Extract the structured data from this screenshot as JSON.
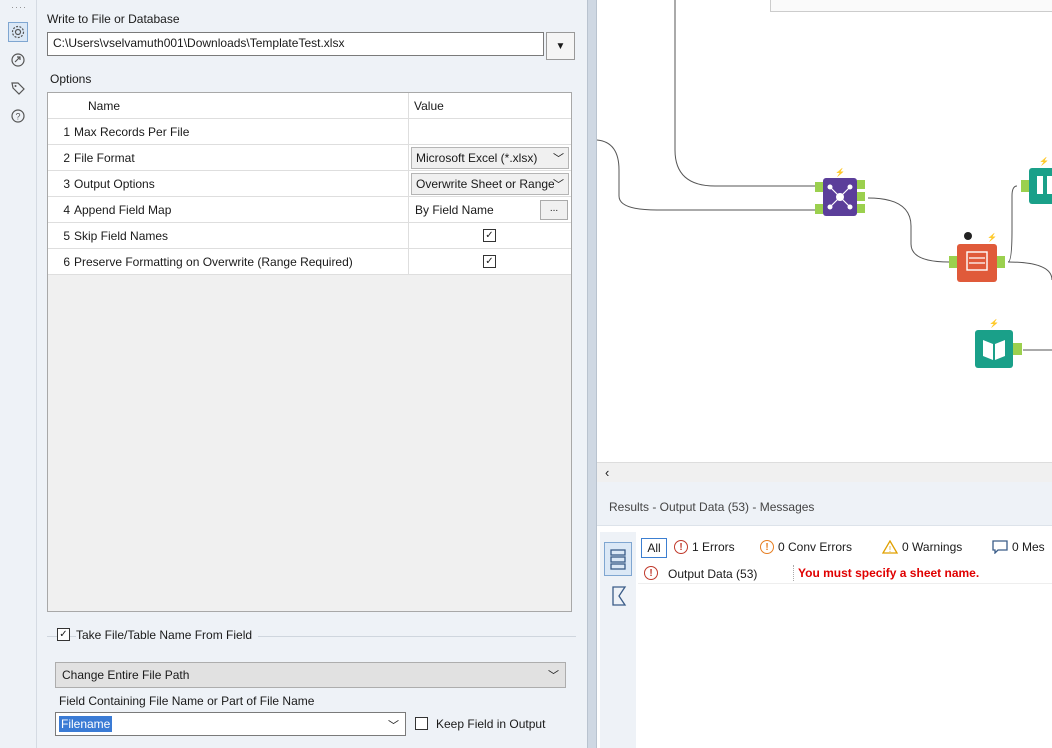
{
  "config": {
    "write_label": "Write to File or Database",
    "path_value": "C:\\Users\\vselvamuth001\\Downloads\\TemplateTest.xlsx",
    "options_label": "Options",
    "grid_headers": {
      "name": "Name",
      "value": "Value"
    },
    "rows": [
      {
        "num": "1",
        "name": "Max Records Per File",
        "value": ""
      },
      {
        "num": "2",
        "name": "File Format",
        "value": "Microsoft Excel (*.xlsx)"
      },
      {
        "num": "3",
        "name": "Output Options",
        "value": "Overwrite Sheet or Range"
      },
      {
        "num": "4",
        "name": "Append Field Map",
        "value": "By Field Name",
        "button": "..."
      },
      {
        "num": "5",
        "name": "Skip Field Names",
        "checked": true
      },
      {
        "num": "6",
        "name": "Preserve Formatting on Overwrite (Range Required)",
        "checked": true
      }
    ],
    "take_name_label": "Take File/Table Name From Field",
    "take_name_checked": true,
    "mode_value": "Change Entire File Path",
    "field_label": "Field Containing File Name or Part of File Name",
    "field_value": "Filename",
    "keep_field_label": "Keep Field in Output",
    "keep_field_checked": false
  },
  "rail": {
    "icons": [
      "gear-icon",
      "connection-progress-icon",
      "tag-icon",
      "help-icon"
    ]
  },
  "canvas": {
    "tools": [
      "join-tool",
      "binoculars-tool",
      "output-data-tool",
      "input-data-tool"
    ]
  },
  "results": {
    "title": "Results - Output Data (53) - Messages",
    "all_label": "All",
    "errors_label": "1 Errors",
    "conv_errors_label": "0 Conv Errors",
    "warnings_label": "0 Warnings",
    "messages_label": "0 Mes",
    "message": {
      "source": "Output Data (53)",
      "text": "You must specify a sheet name."
    }
  },
  "colors": {
    "join_tool": "#5b3e9a",
    "output_tool": "#e05a3a",
    "input_tool": "#1aa089",
    "error_text": "#e00000",
    "accent": "#3a7bd5"
  }
}
